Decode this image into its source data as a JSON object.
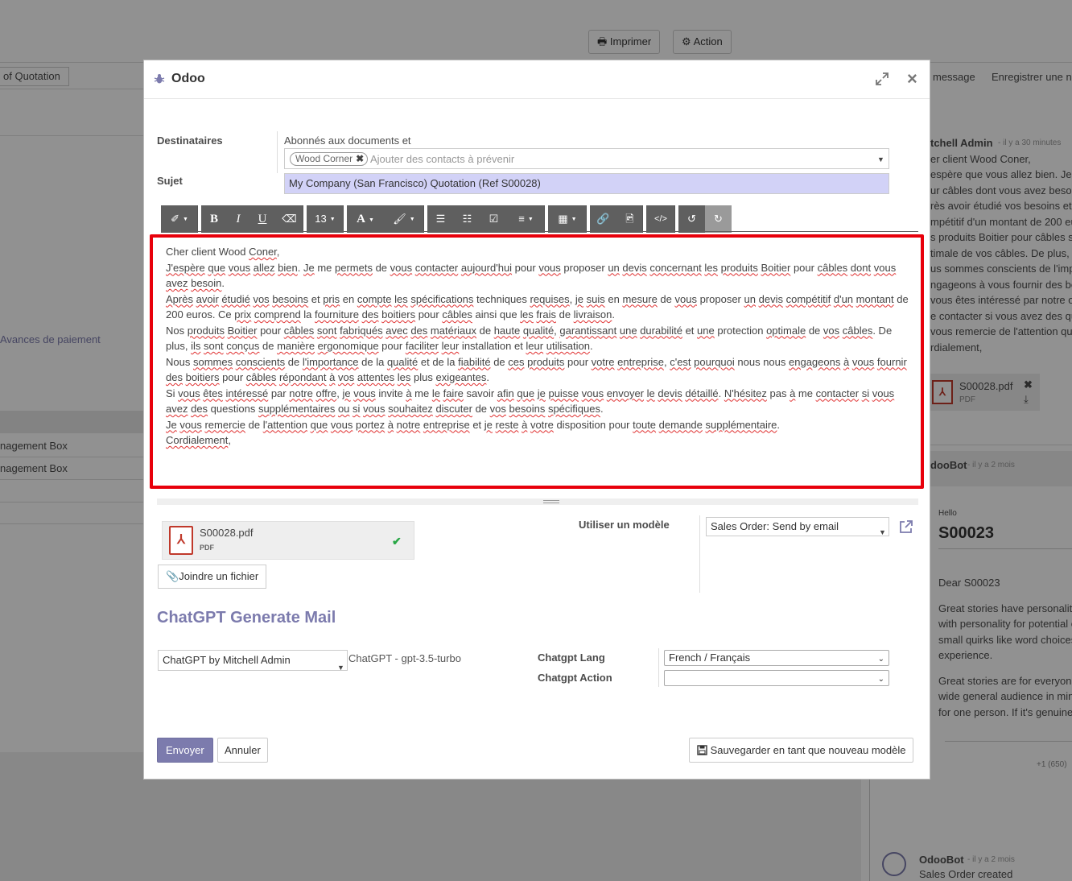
{
  "background": {
    "print_button": "Imprimer",
    "action_button": "Action",
    "left_chip": "of Quotation",
    "left_link": "Avances de paiement",
    "left_rows": [
      "nagement Box",
      "nagement Box"
    ],
    "chatter_links": [
      "message",
      "Enregistrer une n"
    ],
    "chatter_msg1_author": "tchell Admin",
    "chatter_msg1_time": "- il y a 30 minutes",
    "chatter_msg1_lines": [
      "er client Wood Coner,",
      "espère que vous allez bien. Je m",
      "ur câbles dont vous avez beso",
      "rès avoir étudié vos besoins et",
      "mpétitif d'un montant de 200 eu",
      "s produits Boitier pour câbles s",
      "timale de vos câbles. De plus, i",
      "us sommes conscients de l'imp",
      "ngageons à vous fournir des bo",
      "vous êtes intéressé par notre o",
      "e contacter si vous avez des qu",
      "vous remercie de l'attention qu",
      "rdialement,"
    ],
    "chatter_attach_name": "S00028.pdf",
    "chatter_attach_ext": "PDF",
    "chatter_msg2_author": "dooBot",
    "chatter_msg2_time": "- il y a 2 mois",
    "chatter_hello": "Hello",
    "chatter_order": "S00023",
    "chatter_dear": "Dear S00023",
    "chatter_story1": [
      "Great stories have personalit",
      "with personality for potential c",
      "small quirks like word choices",
      "experience."
    ],
    "chatter_story2": [
      "Great stories are for everyon",
      "wide general audience in min",
      "for one person. If it's genuine"
    ],
    "chatter_more": "+1 (650)",
    "chatter_msg3_author": "OdooBot",
    "chatter_msg3_time": "- il y a 2 mois",
    "chatter_msg3_text": "Sales Order created"
  },
  "modal": {
    "title": "Odoo",
    "recipients_label": "Destinataires",
    "subscribers_text": "Abonnés aux documents et",
    "recipient_tag": "Wood Corner",
    "recipients_placeholder": "Ajouter des contacts à prévenir",
    "subject_label": "Sujet",
    "subject_value": "My Company (San Francisco) Quotation (Ref S00028)",
    "toolbar": {
      "font_size": "13"
    },
    "body_paragraphs": [
      "Cher client Wood Coner,",
      "J'espère que vous allez bien. Je me permets de vous contacter aujourd'hui pour vous proposer un devis concernant les produits Boitier pour câbles dont vous avez besoin.",
      "Après avoir étudié vos besoins et pris en compte les spécifications techniques requises, je suis en mesure de vous proposer un devis compétitif d'un montant de 200 euros. Ce prix comprend la fourniture des boitiers pour câbles ainsi que les frais de livraison.",
      "Nos produits Boitier pour câbles sont fabriqués avec des matériaux de haute qualité, garantissant une durabilité et une protection optimale de vos câbles. De plus, ils sont conçus de manière ergonomique pour faciliter leur installation et leur utilisation.",
      "Nous sommes conscients de l'importance de la qualité et de la fiabilité de ces produits pour votre entreprise, c'est pourquoi nous nous engageons à vous fournir des boitiers pour câbles répondant à vos attentes les plus exigeantes.",
      "Si vous êtes intéressé par notre offre, je vous invite à me le faire savoir afin que je puisse vous envoyer le devis détaillé. N'hésitez pas à me contacter si vous avez des questions supplémentaires ou si vous souhaitez discuter de vos besoins spécifiques.",
      "Je vous remercie de l'attention que vous portez à notre entreprise et je reste à votre disposition pour toute demande supplémentaire.",
      "Cordialement,"
    ],
    "attachment_name": "S00028.pdf",
    "attachment_ext": "PDF",
    "attach_button": "Joindre un fichier",
    "template_label": "Utiliser un modèle",
    "template_value": "Sales Order: Send by email",
    "gpt_title": "ChatGPT Generate Mail",
    "gpt_account": "ChatGPT by Mitchell Admin",
    "gpt_model": "ChatGPT - gpt-3.5-turbo",
    "gpt_lang_label": "Chatgpt Lang",
    "gpt_lang_value": "French / Français",
    "gpt_action_label": "Chatgpt Action",
    "gpt_action_value": "",
    "send_button": "Envoyer",
    "cancel_button": "Annuler",
    "save_template_button": "Sauvegarder en tant que nouveau modèle"
  },
  "colors": {
    "accent": "#7c7bad",
    "highlight_box": "#e8000b",
    "subject_bg": "#d2d2f7",
    "toolbar_bg": "#5f5f5f"
  }
}
